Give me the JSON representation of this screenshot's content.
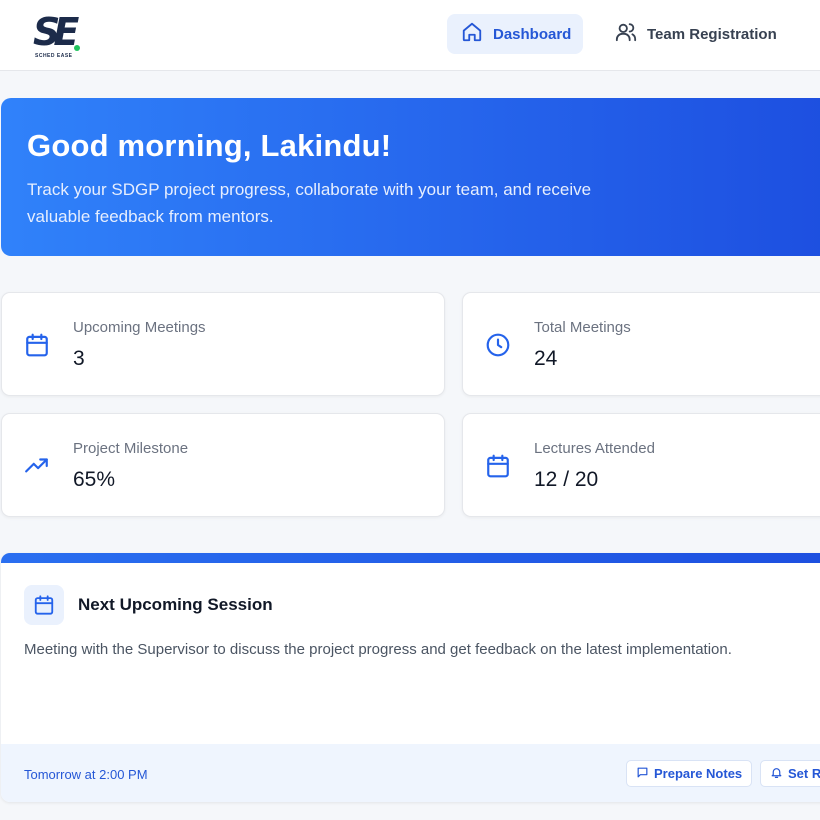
{
  "brand": {
    "logo_text": "SE",
    "logo_subtext": "SCHED EASE",
    "colors": {
      "primary": "#2563eb",
      "accent_dot": "#22c55e",
      "navy": "#1c2b4a"
    }
  },
  "nav": {
    "items": [
      {
        "label": "Dashboard",
        "icon": "home-icon",
        "active": true
      },
      {
        "label": "Team Registration",
        "icon": "users-icon",
        "active": false
      }
    ]
  },
  "hero": {
    "greeting": "Good morning, Lakindu!",
    "subtitle": "Track your SDGP project progress, collaborate with your team, and receive valuable feedback from mentors."
  },
  "stats": [
    {
      "label": "Upcoming Meetings",
      "value": "3",
      "icon": "calendar-icon"
    },
    {
      "label": "Total Meetings",
      "value": "24",
      "icon": "clock-icon"
    },
    {
      "label": "Project Milestone",
      "value": "65%",
      "icon": "trending-up-icon"
    },
    {
      "label": "Lectures Attended",
      "value": "12 / 20",
      "icon": "calendar-icon"
    }
  ],
  "session": {
    "title": "Next Upcoming Session",
    "description": "Meeting with the Supervisor to discuss the project progress and get feedback on the latest implementation.",
    "time": "Tomorrow at 2:00 PM",
    "actions": [
      {
        "label": "Prepare Notes",
        "icon": "message-square-icon"
      },
      {
        "label": "Set Reminder",
        "icon": "bell-icon"
      }
    ]
  }
}
